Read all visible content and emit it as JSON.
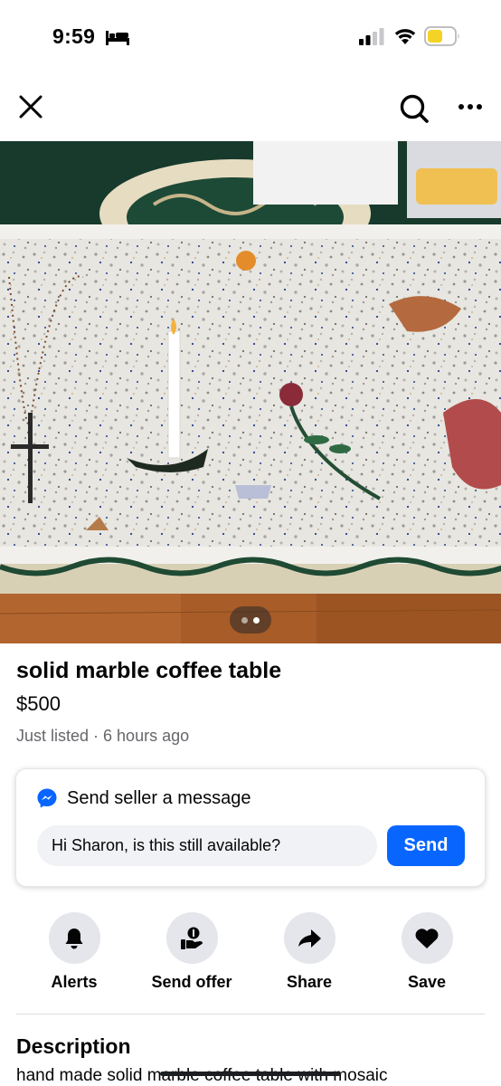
{
  "status_bar": {
    "time": "9:59",
    "icons": [
      "bed-icon",
      "signal-icon",
      "wifi-icon",
      "battery-icon"
    ],
    "battery_color": "#f5d326"
  },
  "nav": {
    "icons": [
      "close-icon",
      "search-icon",
      "more-icon"
    ]
  },
  "photo": {
    "pager_total": 2,
    "pager_active": 1
  },
  "listing": {
    "title": "solid marble coffee table",
    "price": "$500",
    "listed": "Just listed · 6 hours ago"
  },
  "message": {
    "header": "Send seller a message",
    "input_value": "Hi Sharon, is this still available?",
    "send_label": "Send",
    "accent": "#0866ff"
  },
  "actions": [
    {
      "label": "Alerts",
      "icon": "bell-icon"
    },
    {
      "label": "Send offer",
      "icon": "offer-icon"
    },
    {
      "label": "Share",
      "icon": "share-icon"
    },
    {
      "label": "Save",
      "icon": "heart-icon"
    }
  ],
  "description": {
    "heading": "Description",
    "text": "hand made solid marble coffee table with mosaic"
  }
}
